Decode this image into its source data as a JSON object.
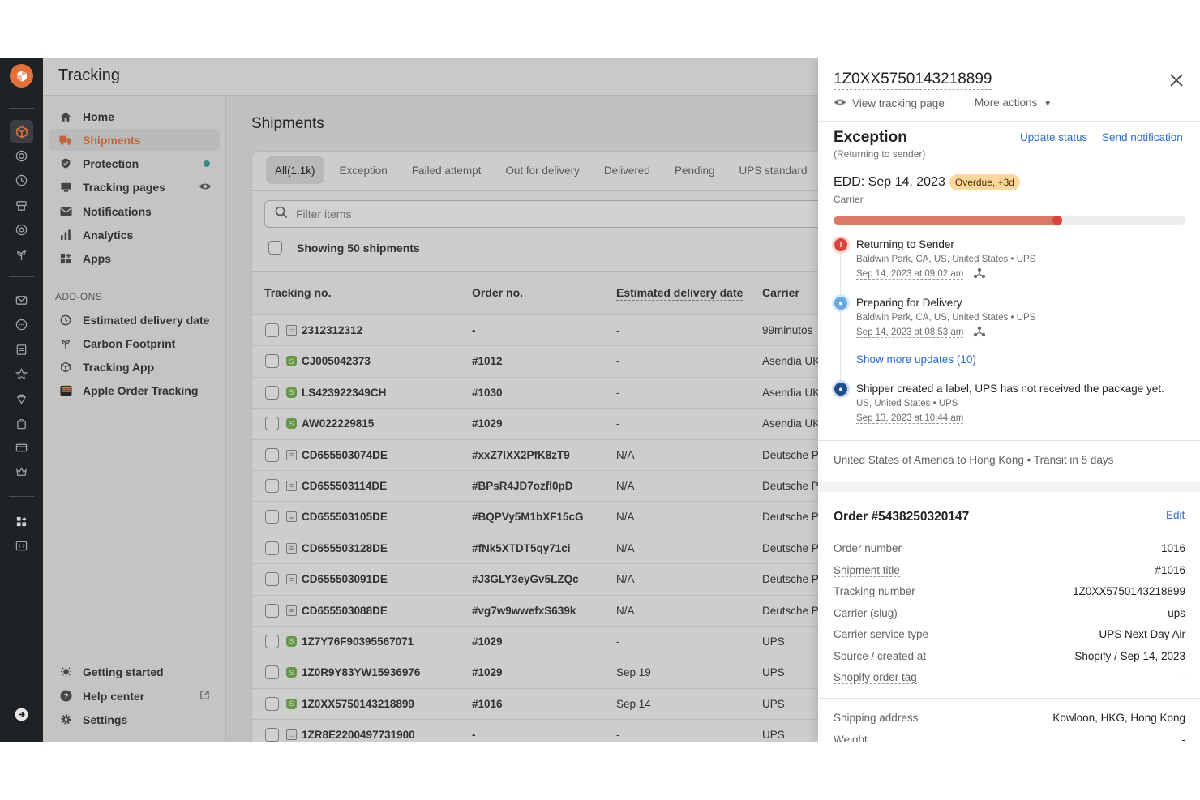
{
  "app": {
    "title": "Tracking"
  },
  "nav": {
    "items": [
      {
        "label": "Home",
        "icon": "home-icon"
      },
      {
        "label": "Shipments",
        "icon": "truck-icon"
      },
      {
        "label": "Protection",
        "icon": "shield-icon"
      },
      {
        "label": "Tracking pages",
        "icon": "monitor-icon"
      },
      {
        "label": "Notifications",
        "icon": "mail-icon"
      },
      {
        "label": "Analytics",
        "icon": "bar-chart-icon"
      },
      {
        "label": "Apps",
        "icon": "apps-icon"
      }
    ],
    "addons_heading": "ADD-ONS",
    "addons": [
      {
        "label": "Estimated delivery date",
        "icon": "clock-icon"
      },
      {
        "label": "Carbon Footprint",
        "icon": "plant-icon"
      },
      {
        "label": "Tracking App",
        "icon": "box-icon"
      },
      {
        "label": "Apple Order Tracking",
        "icon": "wallet-icon"
      }
    ],
    "footer": [
      {
        "label": "Getting started",
        "icon": "bulb-icon"
      },
      {
        "label": "Help center",
        "icon": "help-icon"
      },
      {
        "label": "Settings",
        "icon": "gear-icon"
      }
    ],
    "protection_status_color": "#3aa3a0",
    "active_color": "#e2703a"
  },
  "shipments": {
    "heading": "Shipments",
    "tabs": [
      "All(1.1k)",
      "Exception",
      "Failed attempt",
      "Out for delivery",
      "Delivered",
      "Pending",
      "UPS standard"
    ],
    "filter_placeholder": "Filter items",
    "showing": "Showing 50 shipments",
    "columns": [
      "Tracking no.",
      "Order no.",
      "Estimated delivery date",
      "Carrier"
    ],
    "rows": [
      {
        "tracking": "2312312312",
        "source": "manual",
        "order": "-",
        "edd": "-",
        "carrier": "99minutos"
      },
      {
        "tracking": "CJ005042373",
        "source": "shopify",
        "order": "#1012",
        "edd": "-",
        "carrier": "Asendia UK"
      },
      {
        "tracking": "LS423922349CH",
        "source": "shopify",
        "order": "#1030",
        "edd": "-",
        "carrier": "Asendia UK"
      },
      {
        "tracking": "AW022229815",
        "source": "shopify",
        "order": "#1029",
        "edd": "-",
        "carrier": "Asendia UK"
      },
      {
        "tracking": "CD655503074DE",
        "source": "api",
        "order": "#xxZ7lXX2PfK8zT9",
        "edd": "N/A",
        "carrier": "Deutsche Po"
      },
      {
        "tracking": "CD655503114DE",
        "source": "api",
        "order": "#BPsR4JD7ozfl0pD",
        "edd": "N/A",
        "carrier": "Deutsche Po"
      },
      {
        "tracking": "CD655503105DE",
        "source": "api",
        "order": "#BQPVy5M1bXF15cG",
        "edd": "N/A",
        "carrier": "Deutsche Po"
      },
      {
        "tracking": "CD655503128DE",
        "source": "api",
        "order": "#fNk5XTDT5qy71ci",
        "edd": "N/A",
        "carrier": "Deutsche Po"
      },
      {
        "tracking": "CD655503091DE",
        "source": "api",
        "order": "#J3GLY3eyGv5LZQc",
        "edd": "N/A",
        "carrier": "Deutsche Po"
      },
      {
        "tracking": "CD655503088DE",
        "source": "api",
        "order": "#vg7w9wwefxS639k",
        "edd": "N/A",
        "carrier": "Deutsche Po"
      },
      {
        "tracking": "1Z7Y76F90395567071",
        "source": "shopify",
        "order": "#1029",
        "edd": "-",
        "carrier": "UPS"
      },
      {
        "tracking": "1Z0R9Y83YW15936976",
        "source": "shopify",
        "order": "#1029",
        "edd": "Sep 19",
        "carrier": "UPS"
      },
      {
        "tracking": "1Z0XX5750143218899",
        "source": "shopify",
        "order": "#1016",
        "edd": "Sep 14",
        "carrier": "UPS"
      },
      {
        "tracking": "1ZR8E2200497731900",
        "source": "manual",
        "order": "-",
        "edd": "-",
        "carrier": "UPS"
      }
    ]
  },
  "drawer": {
    "tracking_number": "1Z0XX5750143218899",
    "view_tracking_page": "View tracking page",
    "more_actions": "More actions",
    "status": "Exception",
    "status_sub": "(Returning to sender)",
    "update_status": "Update status",
    "send_notification": "Send notification",
    "edd": "EDD: Sep 14, 2023",
    "edd_badge": "Overdue, +3d",
    "edd_source": "Carrier",
    "progress": 0.64,
    "progress_color": "#d97a6a",
    "events": [
      {
        "title": "Returning to Sender",
        "location": "Baldwin Park, CA, US, United States • UPS",
        "date": "Sep 14, 2023 at 09:02 am",
        "color": "#d9453a"
      },
      {
        "title": "Preparing for Delivery",
        "location": "Baldwin Park, CA, US, United States • UPS",
        "date": "Sep 14, 2023 at 08:53 am",
        "color": "#6aa8e0"
      }
    ],
    "show_more": "Show more updates (10)",
    "first_event": {
      "title": "Shipper created a label, UPS has not received the package yet.",
      "location": "US, United States • UPS",
      "date": "Sep 13, 2023 at 10:44 am",
      "color": "#1f4e8c"
    },
    "route": "United States of America to Hong Kong • Transit in 5 days",
    "order_title": "Order #5438250320147",
    "edit": "Edit",
    "details": [
      {
        "key": "Order number",
        "value": "1016"
      },
      {
        "key": "Shipment title",
        "value": "#1016"
      },
      {
        "key": "Tracking number",
        "value": "1Z0XX5750143218899"
      },
      {
        "key": "Carrier (slug)",
        "value": "ups"
      },
      {
        "key": "Carrier service type",
        "value": "UPS Next Day Air"
      },
      {
        "key": "Source / created at",
        "value": "Shopify / Sep 14, 2023"
      },
      {
        "key": "Shopify order tag",
        "value": "-"
      }
    ],
    "shipping": [
      {
        "key": "Shipping address",
        "value": "Kowloon, HKG, Hong Kong"
      },
      {
        "key": "Weight",
        "value": "-"
      }
    ]
  }
}
